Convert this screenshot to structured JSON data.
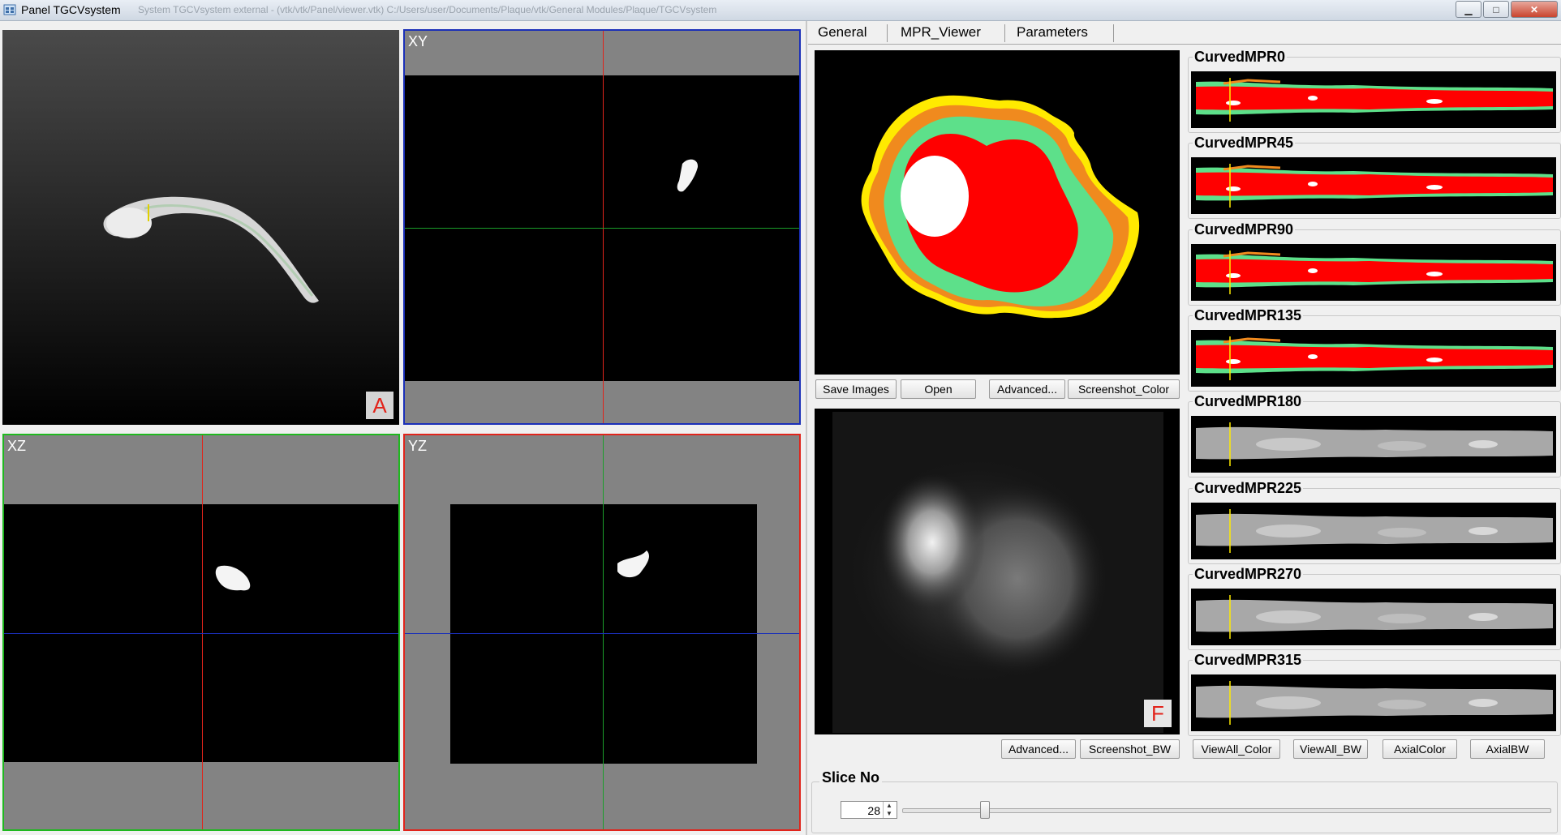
{
  "window": {
    "title": "Panel TGCVsystem",
    "path": "System TGCVsystem  external - (vtk/vtk/Panel/viewer.vtk)   C:/Users/user/Documents/Plaque/vtk/General Modules/Plaque/TGCVsystem",
    "controls": {
      "minimize": "▁",
      "maximize": "□",
      "close": "✕"
    }
  },
  "viewports": {
    "a": {
      "corner": "A"
    },
    "xy": {
      "label": "XY"
    },
    "xz": {
      "label": "XZ"
    },
    "yz": {
      "label": "YZ"
    }
  },
  "tabs": [
    "General",
    "MPR_Viewer",
    "Parameters"
  ],
  "active_tab": "MPR_Viewer",
  "mpr_color_buttons": {
    "save_images": "Save Images",
    "open": "Open",
    "advanced": "Advanced...",
    "screenshot_color": "Screenshot_Color"
  },
  "mpr_bw": {
    "corner": "F",
    "advanced": "Advanced...",
    "screenshot_bw": "Screenshot_BW"
  },
  "curved_mpr": [
    {
      "label": "CurvedMPR0",
      "mode": "color"
    },
    {
      "label": "CurvedMPR45",
      "mode": "color"
    },
    {
      "label": "CurvedMPR90",
      "mode": "color"
    },
    {
      "label": "CurvedMPR135",
      "mode": "color"
    },
    {
      "label": "CurvedMPR180",
      "mode": "bw"
    },
    {
      "label": "CurvedMPR225",
      "mode": "bw"
    },
    {
      "label": "CurvedMPR270",
      "mode": "bw"
    },
    {
      "label": "CurvedMPR315",
      "mode": "bw"
    }
  ],
  "view_buttons": {
    "view_all_color": "ViewAll_Color",
    "view_all_bw": "ViewAll_BW",
    "axial_color": "AxialColor",
    "axial_bw": "AxialBW"
  },
  "slice": {
    "title": "Slice No",
    "value": "28",
    "slider_fraction": 0.12
  },
  "colors": {
    "red_line": "#e0241b",
    "green_line": "#1b9e2a",
    "blue_line": "#1a2fb8",
    "plaque_red": "#ff0000",
    "plaque_green": "#5de08a",
    "plaque_orange": "#f08a1e",
    "plaque_yellow": "#ffea00"
  }
}
